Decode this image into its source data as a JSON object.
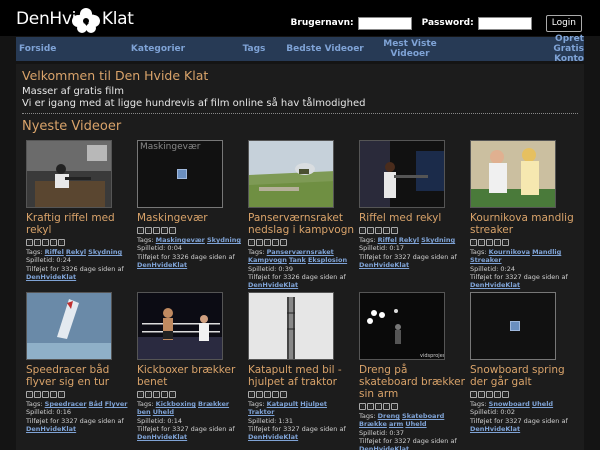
{
  "header": {
    "logo": "DenHvide Klat",
    "username_label": "Brugernavn:",
    "password_label": "Password:",
    "login_label": "Login"
  },
  "nav": [
    {
      "label": "Forside"
    },
    {
      "label": "Kategorier"
    },
    {
      "label": "Tags"
    },
    {
      "label": "Bedste Videoer"
    },
    {
      "label": "Mest Viste Videoer"
    },
    {
      "label": "Opret Gratis Konto"
    }
  ],
  "welcome": {
    "title": "Velkommen til Den Hvide Klat",
    "line1": "Masser af gratis film",
    "line2": "Vi er igang med at ligge hundrevis af film online så hav tålmodighed"
  },
  "section_title": "Nyeste Videoer",
  "labels": {
    "tags": "Tags:",
    "duration": "Spilletid:",
    "added": "Tilføjet for",
    "days": "dage siden af"
  },
  "videos": [
    {
      "title": "Kraftig riffel med rekyl",
      "tags": [
        "Riffel",
        "Rekyl",
        "Skydning"
      ],
      "duration": "0:24",
      "days": "3326",
      "user": "DenHvideKlat",
      "thumb": "office"
    },
    {
      "title": "Maskingevær",
      "tags": [
        "Maskingevær",
        "Skydning"
      ],
      "duration": "0:04",
      "days": "3326",
      "user": "DenHvideKlat",
      "thumb": "placeholder",
      "placeholder_text": "Maskingevær"
    },
    {
      "title": "Panserværnsraket nedslag i kampvogn",
      "tags": [
        "Panserværnsraket",
        "Kampvogn",
        "Tank",
        "Eksplosion"
      ],
      "duration": "0:39",
      "days": "3326",
      "user": "DenHvideKlat",
      "thumb": "field"
    },
    {
      "title": "Riffel med rekyl",
      "tags": [
        "Riffel",
        "Rekyl",
        "Skydning"
      ],
      "duration": "0:17",
      "days": "3327",
      "user": "DenHvideKlat",
      "thumb": "rifle"
    },
    {
      "title": "Kournikova mandlig streaker",
      "tags": [
        "Kournikova",
        "Mandlig",
        "Streaker"
      ],
      "duration": "0:24",
      "days": "3327",
      "user": "DenHvideKlat",
      "thumb": "tennis"
    },
    {
      "title": "Speedracer båd flyver sig en tur",
      "tags": [
        "Speedracer",
        "Båd",
        "Flyver"
      ],
      "duration": "0:16",
      "days": "3327",
      "user": "DenHvideKlat",
      "thumb": "boat"
    },
    {
      "title": "Kickboxer brækker benet",
      "tags": [
        "Kickboxing",
        "Brækker",
        "ben",
        "Uheld"
      ],
      "duration": "0:14",
      "days": "3327",
      "user": "DenHvideKlat",
      "thumb": "boxing"
    },
    {
      "title": "Katapult med bil - hjulpet af traktor",
      "tags": [
        "Katapult",
        "Hjulpet",
        "Traktor"
      ],
      "duration": "1:31",
      "days": "3327",
      "user": "DenHvideKlat",
      "thumb": "tower"
    },
    {
      "title": "Dreng på skateboard brækker sin arm",
      "tags": [
        "Dreng",
        "Skateboard",
        "Brække",
        "arm",
        "Uheld"
      ],
      "duration": "0:37",
      "days": "3327",
      "user": "DenHvideKlat",
      "thumb": "skate",
      "watermark": "vidsproject.com"
    },
    {
      "title": "Snowboard spring der går galt",
      "tags": [
        "Snowboard",
        "Uheld"
      ],
      "duration": "0:02",
      "days": "3327",
      "user": "DenHvideKlat",
      "thumb": "placeholder",
      "placeholder_text": ""
    }
  ]
}
